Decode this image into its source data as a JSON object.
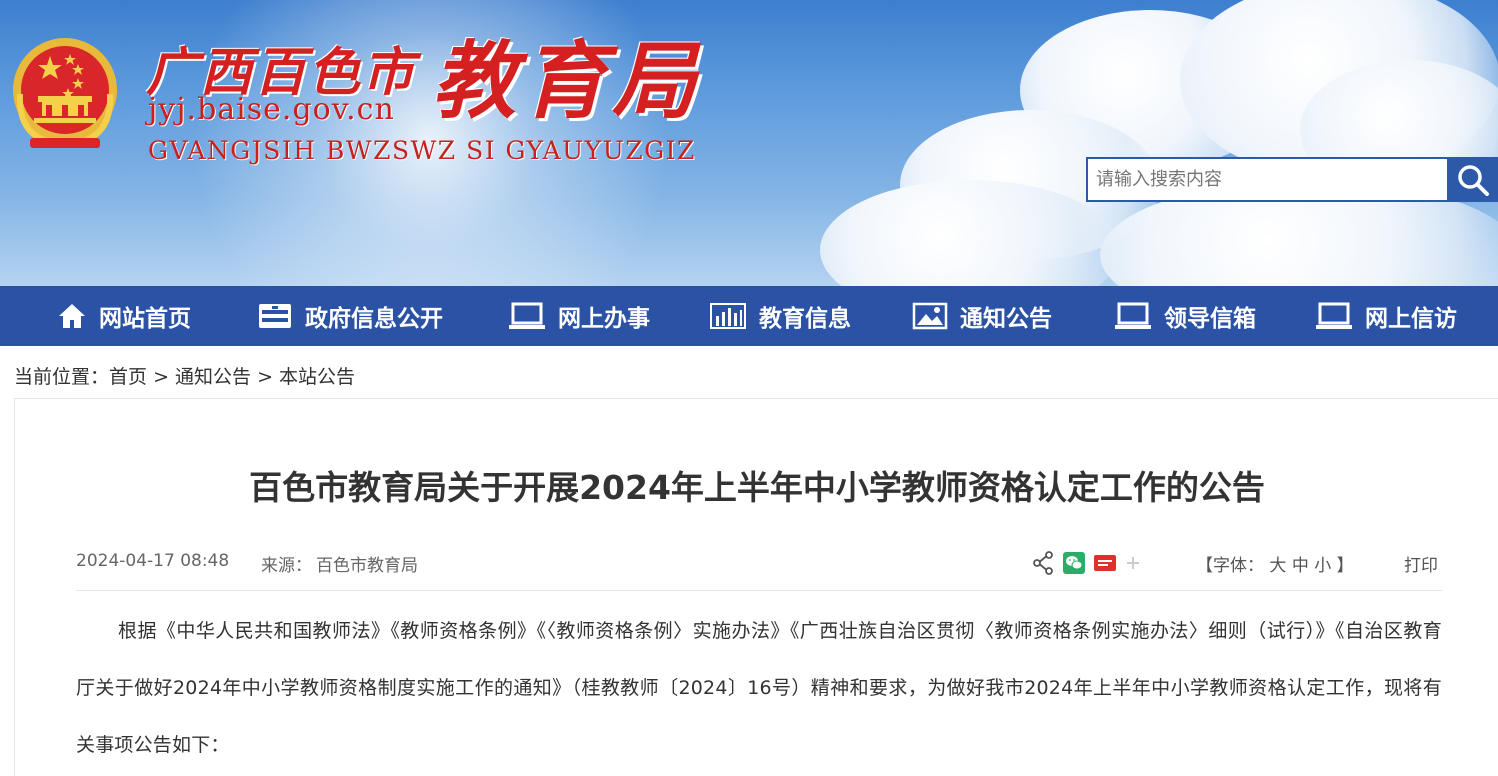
{
  "header": {
    "logo_cn": "广西百色市",
    "logo_cn_big": "教育局",
    "logo_url": "jyj.baise.gov.cn",
    "logo_zhuang": "GVANGJSIH BWZSWZ SI GYAUYUZGIZ",
    "search_placeholder": "请输入搜索内容",
    "search_icon": "magnifier-icon",
    "emblem_icon": "national-emblem-icon"
  },
  "nav": {
    "items": [
      {
        "label": "网站首页",
        "icon": "home-icon"
      },
      {
        "label": "政府信息公开",
        "icon": "cabinet-icon"
      },
      {
        "label": "网上办事",
        "icon": "monitor-icon"
      },
      {
        "label": "教育信息",
        "icon": "bar-chart-icon"
      },
      {
        "label": "通知公告",
        "icon": "image-icon"
      },
      {
        "label": "领导信箱",
        "icon": "monitor-icon"
      },
      {
        "label": "网上信访",
        "icon": "monitor-icon"
      }
    ]
  },
  "breadcrumb": {
    "prefix": "当前位置：",
    "items": [
      "首页",
      "通知公告",
      "本站公告"
    ],
    "separator": " > "
  },
  "article": {
    "title": "百色市教育局关于开展2024年上半年中小学教师资格认定工作的公告",
    "date": "2024-04-17 08:48",
    "source_label": "来源：",
    "source": "百色市教育局",
    "share_icons": [
      "share-icon",
      "wechat-icon",
      "toutiao-icon",
      "plus-icon"
    ],
    "font_label": "【字体：",
    "font_large": "大",
    "font_medium": "中",
    "font_small": "小",
    "font_end": "】",
    "print": "打印",
    "paragraph": "根据《中华人民共和国教师法》《教师资格条例》《〈教师资格条例〉实施办法》《广西壮族自治区贯彻〈教师资格条例实施办法〉细则（试行）》《自治区教育厅关于做好2024年中小学教师资格制度实施工作的通知》（桂教教师〔2024〕16号）精神和要求，为做好我市2024年上半年中小学教师资格认定工作，现将有关事项公告如下："
  },
  "colors": {
    "nav_bg": "#2b52a5",
    "logo_red": "#d42020",
    "search_border": "#2d5aa8"
  }
}
